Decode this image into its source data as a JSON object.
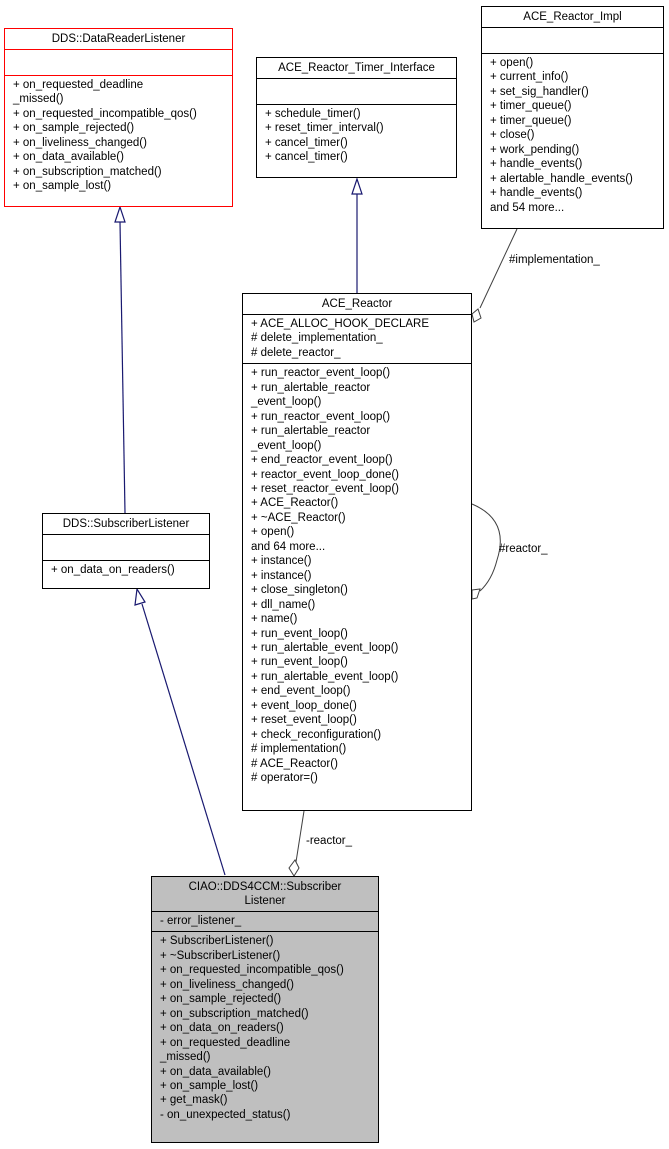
{
  "classes": {
    "data_reader_listener": {
      "name": "DDS::DataReaderListener",
      "attributes": [],
      "methods": [
        "+ on_requested_deadline",
        "_missed()",
        "+ on_requested_incompatible_qos()",
        "+ on_sample_rejected()",
        "+ on_liveliness_changed()",
        "+ on_data_available()",
        "+ on_subscription_matched()",
        "+ on_sample_lost()"
      ],
      "border_color": "#ff0000"
    },
    "timer_interface": {
      "name": "ACE_Reactor_Timer_Interface",
      "attributes": [],
      "methods": [
        "+ schedule_timer()",
        "+ reset_timer_interval()",
        "+ cancel_timer()",
        "+ cancel_timer()"
      ]
    },
    "reactor_impl": {
      "name": "ACE_Reactor_Impl",
      "attributes": [],
      "methods": [
        "+ open()",
        "+ current_info()",
        "+ set_sig_handler()",
        "+ timer_queue()",
        "+ timer_queue()",
        "+ close()",
        "+ work_pending()",
        "+ handle_events()",
        "+ alertable_handle_events()",
        "+ handle_events()",
        "and 54 more..."
      ]
    },
    "ace_reactor": {
      "name": "ACE_Reactor",
      "attributes": [
        "+ ACE_ALLOC_HOOK_DECLARE",
        "# delete_implementation_",
        "# delete_reactor_"
      ],
      "methods": [
        "+ run_reactor_event_loop()",
        "+ run_alertable_reactor",
        "_event_loop()",
        "+ run_reactor_event_loop()",
        "+ run_alertable_reactor",
        "_event_loop()",
        "+ end_reactor_event_loop()",
        "+ reactor_event_loop_done()",
        "+ reset_reactor_event_loop()",
        "+ ACE_Reactor()",
        "+ ~ACE_Reactor()",
        "+ open()",
        "and 64 more...",
        "+ instance()",
        "+ instance()",
        "+ close_singleton()",
        "+ dll_name()",
        "+ name()",
        "+ run_event_loop()",
        "+ run_alertable_event_loop()",
        "+ run_event_loop()",
        "+ run_alertable_event_loop()",
        "+ end_event_loop()",
        "+ event_loop_done()",
        "+ reset_event_loop()",
        "+ check_reconfiguration()",
        "# implementation()",
        "# ACE_Reactor()",
        "# operator=()"
      ]
    },
    "subscriber_listener": {
      "name": "DDS::SubscriberListener",
      "attributes": [],
      "methods": [
        "+ on_data_on_readers()"
      ]
    },
    "ciao_subscriber_listener": {
      "name_line1": "CIAO::DDS4CCM::Subscriber",
      "name_line2": "Listener",
      "attributes": [
        "- error_listener_"
      ],
      "methods": [
        "+ SubscriberListener()",
        "+ ~SubscriberListener()",
        "+ on_requested_incompatible_qos()",
        "+ on_liveliness_changed()",
        "+ on_sample_rejected()",
        "+ on_subscription_matched()",
        "+ on_data_on_readers()",
        "+ on_requested_deadline",
        "_missed()",
        "+ on_data_available()",
        "+ on_sample_lost()",
        "+ get_mask()",
        "- on_unexpected_status()"
      ],
      "background": "#bfbfbf"
    }
  },
  "edge_labels": {
    "implementation": "#implementation_",
    "reactor_self": "#reactor_",
    "reactor_member": "-reactor_"
  },
  "colors": {
    "inheritance_edge": "#191970",
    "association_edge": "#404040"
  }
}
